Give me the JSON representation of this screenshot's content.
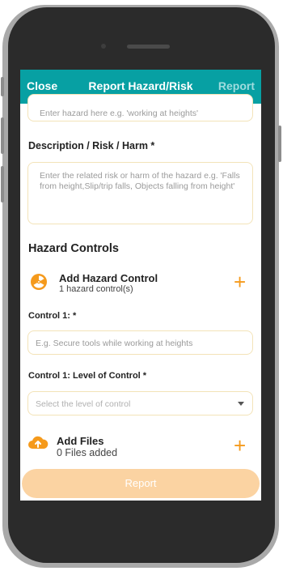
{
  "header": {
    "close_label": "Close",
    "title": "Report Hazard/Risk",
    "report_label": "Report"
  },
  "hazard_field": {
    "placeholder": "Enter hazard here e.g. 'working at heights'"
  },
  "description": {
    "label": "Description / Risk / Harm *",
    "placeholder": "Enter the related risk or harm of the hazard e.g. 'Falls from height,Slip/trip falls, Objects falling from height'"
  },
  "hazard_controls": {
    "section_title": "Hazard Controls",
    "add_title": "Add Hazard Control",
    "count_text": "1 hazard control(s)"
  },
  "control_1": {
    "label": "Control 1: *",
    "placeholder": "E.g. Secure tools while working at heights",
    "level_label": "Control 1: Level of Control *",
    "level_placeholder": "Select the level of control"
  },
  "files": {
    "title": "Add Files",
    "count_text": "0 Files added"
  },
  "report_button": {
    "label": "Report"
  },
  "colors": {
    "header": "#07a0a3",
    "accent": "#f59a1c",
    "button_disabled": "#fbd3a2",
    "input_border": "#f3e3b8"
  }
}
